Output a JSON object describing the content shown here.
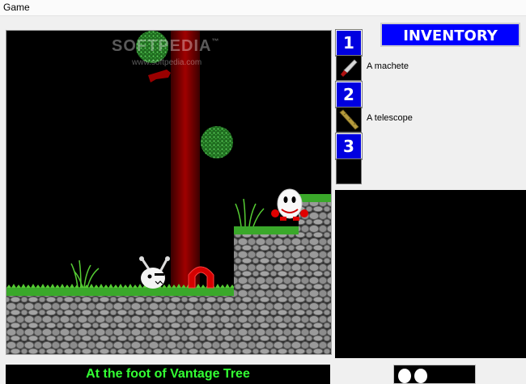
{
  "menu": {
    "game_label": "Game"
  },
  "watermark": {
    "brand": "SOFTPEDIA",
    "trademark": "™",
    "url": "www.softpedia.com"
  },
  "inventory": {
    "title": "INVENTORY",
    "slots": [
      {
        "number": "1",
        "item": "A machete",
        "icon": "machete-icon"
      },
      {
        "number": "2",
        "item": "A telescope",
        "icon": "telescope-icon"
      },
      {
        "number": "3",
        "item": "",
        "icon": "empty-slot"
      }
    ]
  },
  "status": {
    "location": "At the foot of Vantage Tree",
    "lives": 2
  },
  "colors": {
    "background": "#000000",
    "slot_blue": "#0000e0",
    "header_blue": "#0000ff",
    "location_text": "#33ff33",
    "tree_trunk": "#8b0000",
    "foliage": "#2f8f2f",
    "grass": "#55cc33",
    "stone": "#8a8a8a"
  }
}
